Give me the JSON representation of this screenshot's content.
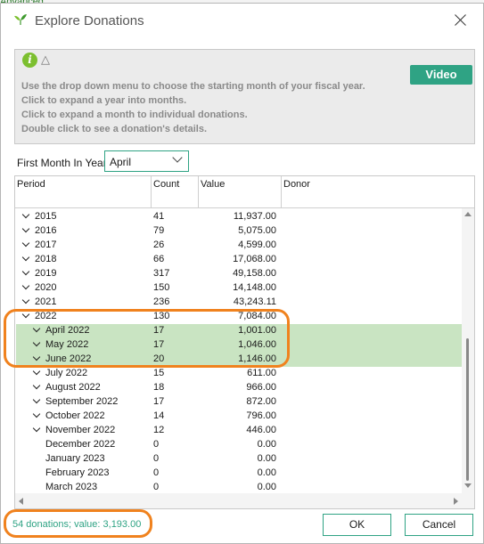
{
  "behind": {
    "tab_label": "Advanced"
  },
  "window": {
    "title": "Explore Donations"
  },
  "info": {
    "video_label": "Video",
    "lines": [
      "Use the drop down menu to choose the starting month of your fiscal year.",
      "Click to expand a year into months.",
      "Click to expand a month to individual donations.",
      "Double click to see a donation's details."
    ]
  },
  "first_month": {
    "label": "First Month In Year",
    "value": "April"
  },
  "grid": {
    "columns": [
      "Period",
      "Count",
      "Value",
      "Donor"
    ],
    "rows": [
      {
        "period": "2015",
        "count": "41",
        "value": "11,937.00",
        "expander": true,
        "indent": 0,
        "highlight": false
      },
      {
        "period": "2016",
        "count": "79",
        "value": "5,075.00",
        "expander": true,
        "indent": 0,
        "highlight": false
      },
      {
        "period": "2017",
        "count": "26",
        "value": "4,599.00",
        "expander": true,
        "indent": 0,
        "highlight": false
      },
      {
        "period": "2018",
        "count": "66",
        "value": "17,068.00",
        "expander": true,
        "indent": 0,
        "highlight": false
      },
      {
        "period": "2019",
        "count": "317",
        "value": "49,158.00",
        "expander": true,
        "indent": 0,
        "highlight": false
      },
      {
        "period": "2020",
        "count": "150",
        "value": "14,148.00",
        "expander": true,
        "indent": 0,
        "highlight": false
      },
      {
        "period": "2021",
        "count": "236",
        "value": "43,243.11",
        "expander": true,
        "indent": 0,
        "highlight": false
      },
      {
        "period": "2022",
        "count": "130",
        "value": "7,084.00",
        "expander": true,
        "indent": 0,
        "highlight": false
      },
      {
        "period": "April 2022",
        "count": "17",
        "value": "1,001.00",
        "expander": true,
        "indent": 1,
        "highlight": true
      },
      {
        "period": "May 2022",
        "count": "17",
        "value": "1,046.00",
        "expander": true,
        "indent": 1,
        "highlight": true
      },
      {
        "period": "June 2022",
        "count": "20",
        "value": "1,146.00",
        "expander": true,
        "indent": 1,
        "highlight": true
      },
      {
        "period": "July 2022",
        "count": "15",
        "value": "611.00",
        "expander": true,
        "indent": 1,
        "highlight": false
      },
      {
        "period": "August 2022",
        "count": "18",
        "value": "966.00",
        "expander": true,
        "indent": 1,
        "highlight": false
      },
      {
        "period": "September 2022",
        "count": "17",
        "value": "872.00",
        "expander": true,
        "indent": 1,
        "highlight": false
      },
      {
        "period": "October 2022",
        "count": "14",
        "value": "796.00",
        "expander": true,
        "indent": 1,
        "highlight": false
      },
      {
        "period": "November 2022",
        "count": "12",
        "value": "446.00",
        "expander": true,
        "indent": 1,
        "highlight": false
      },
      {
        "period": "December 2022",
        "count": "0",
        "value": "0.00",
        "expander": false,
        "indent": 1,
        "highlight": false
      },
      {
        "period": "January 2023",
        "count": "0",
        "value": "0.00",
        "expander": false,
        "indent": 1,
        "highlight": false
      },
      {
        "period": "February 2023",
        "count": "0",
        "value": "0.00",
        "expander": false,
        "indent": 1,
        "highlight": false
      },
      {
        "period": "March 2023",
        "count": "0",
        "value": "0.00",
        "expander": false,
        "indent": 1,
        "highlight": false
      }
    ]
  },
  "status": {
    "text": "54 donations; value: 3,193.00"
  },
  "buttons": {
    "ok": "OK",
    "cancel": "Cancel"
  },
  "colors": {
    "accent": "#2fa384",
    "highlight": "#c9e4c2",
    "annotation": "#f0821e"
  }
}
